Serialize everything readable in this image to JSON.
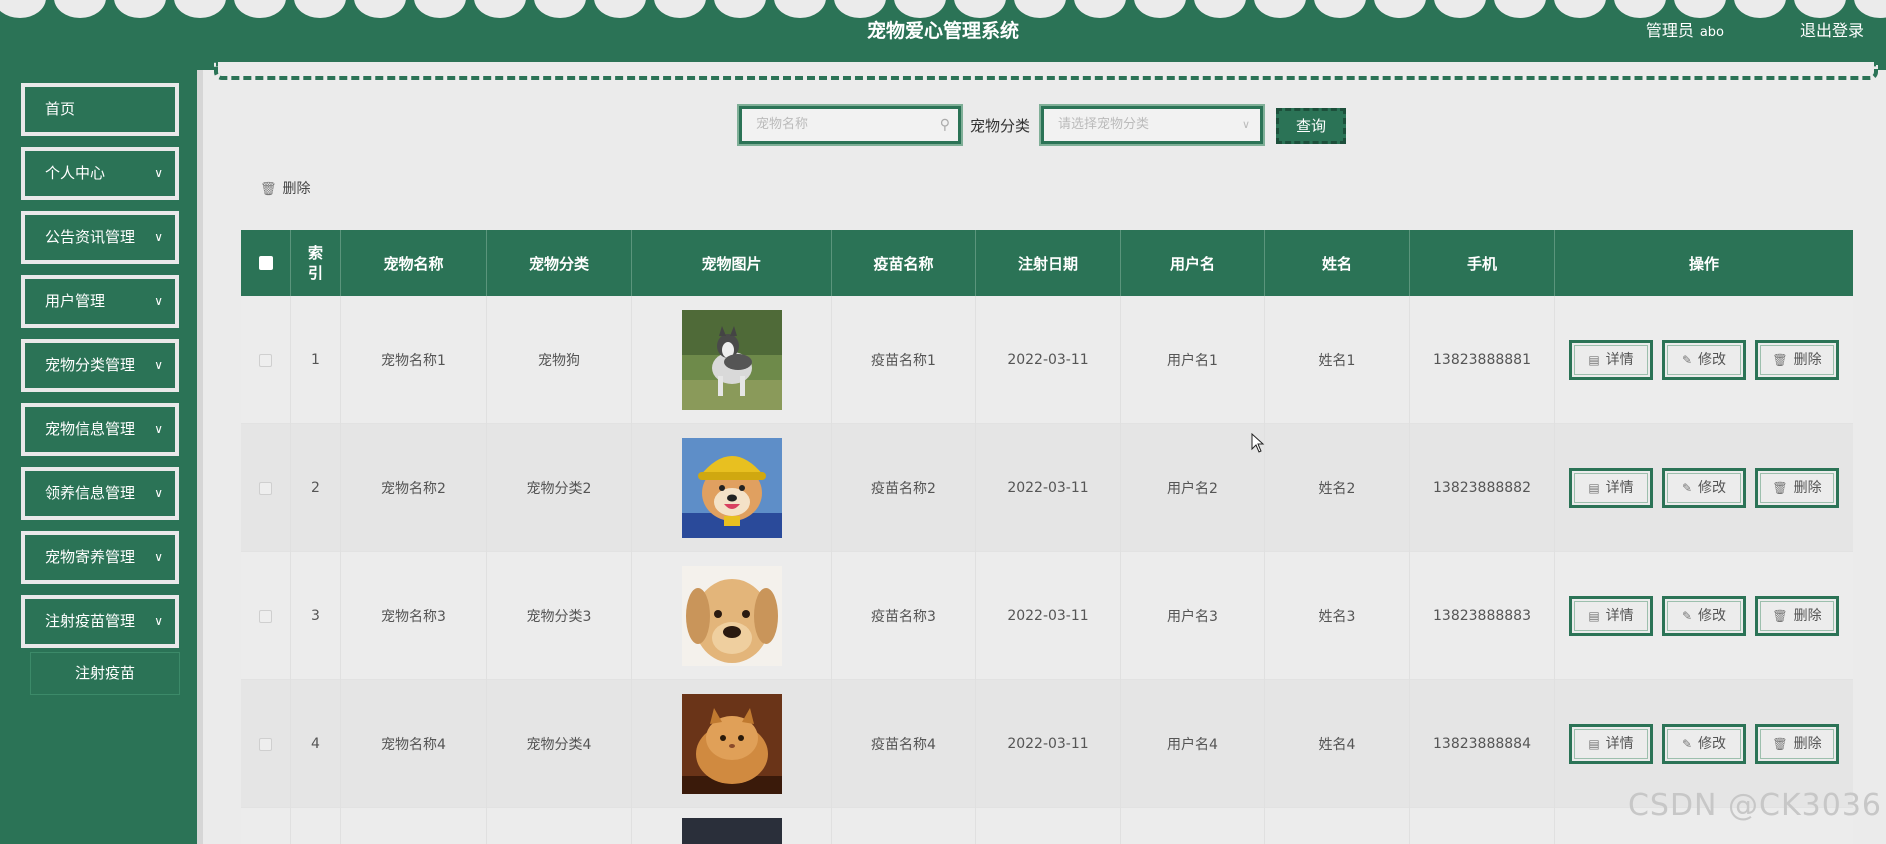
{
  "header": {
    "title": "宠物爱心管理系统",
    "user_role": "管理员",
    "username": "abo",
    "logout_label": "退出登录"
  },
  "sidebar": {
    "items": [
      {
        "label": "首页",
        "expandable": false
      },
      {
        "label": "个人中心",
        "expandable": true
      },
      {
        "label": "公告资讯管理",
        "expandable": true
      },
      {
        "label": "用户管理",
        "expandable": true
      },
      {
        "label": "宠物分类管理",
        "expandable": true
      },
      {
        "label": "宠物信息管理",
        "expandable": true
      },
      {
        "label": "领养信息管理",
        "expandable": true
      },
      {
        "label": "宠物寄养管理",
        "expandable": true
      },
      {
        "label": "注射疫苗管理",
        "expandable": true
      }
    ],
    "submenu_label": "注射疫苗"
  },
  "search": {
    "name_placeholder": "宠物名称",
    "category_label": "宠物分类",
    "category_placeholder": "请选择宠物分类",
    "query_label": "查询"
  },
  "toolbar": {
    "delete_label": "删除"
  },
  "table": {
    "columns": [
      "索引",
      "宠物名称",
      "宠物分类",
      "宠物图片",
      "疫苗名称",
      "注射日期",
      "用户名",
      "姓名",
      "手机",
      "操作"
    ],
    "rows": [
      {
        "index": "1",
        "pet_name": "宠物名称1",
        "category": "宠物狗",
        "image": "husky-photo",
        "vaccine": "疫苗名称1",
        "date": "2022-03-11",
        "username": "用户名1",
        "name": "姓名1",
        "phone": "13823888881"
      },
      {
        "index": "2",
        "pet_name": "宠物名称2",
        "category": "宠物分类2",
        "image": "shiba-hat-photo",
        "vaccine": "疫苗名称2",
        "date": "2022-03-11",
        "username": "用户名2",
        "name": "姓名2",
        "phone": "13823888882"
      },
      {
        "index": "3",
        "pet_name": "宠物名称3",
        "category": "宠物分类3",
        "image": "labrador-photo",
        "vaccine": "疫苗名称3",
        "date": "2022-03-11",
        "username": "用户名3",
        "name": "姓名3",
        "phone": "13823888883"
      },
      {
        "index": "4",
        "pet_name": "宠物名称4",
        "category": "宠物分类4",
        "image": "persian-cat-photo",
        "vaccine": "疫苗名称4",
        "date": "2022-03-11",
        "username": "用户名4",
        "name": "姓名4",
        "phone": "13823888884"
      }
    ],
    "actions": {
      "detail": "详情",
      "edit": "修改",
      "delete": "删除"
    }
  },
  "watermark": "CSDN @CK3036",
  "colors": {
    "primary": "#2b7356",
    "background": "#ebebeb"
  }
}
